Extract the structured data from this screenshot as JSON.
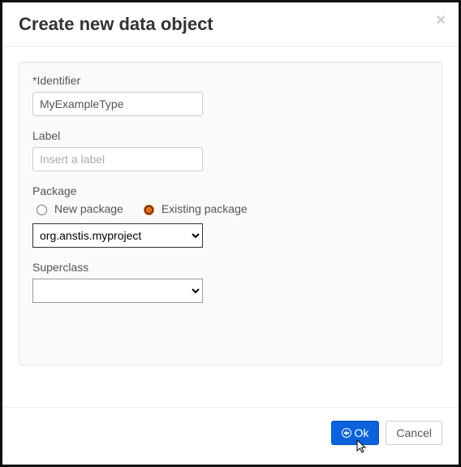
{
  "header": {
    "title": "Create new data object"
  },
  "form": {
    "identifier": {
      "label": "*Identifier",
      "value": "MyExampleType"
    },
    "label": {
      "label": "Label",
      "placeholder": "Insert a label",
      "value": ""
    },
    "package": {
      "label": "Package",
      "radios": {
        "new": "New package",
        "existing": "Existing package",
        "selected": "existing"
      },
      "selected_value": "org.anstis.myproject"
    },
    "superclass": {
      "label": "Superclass",
      "selected_value": ""
    }
  },
  "footer": {
    "ok": "Ok",
    "cancel": "Cancel"
  }
}
